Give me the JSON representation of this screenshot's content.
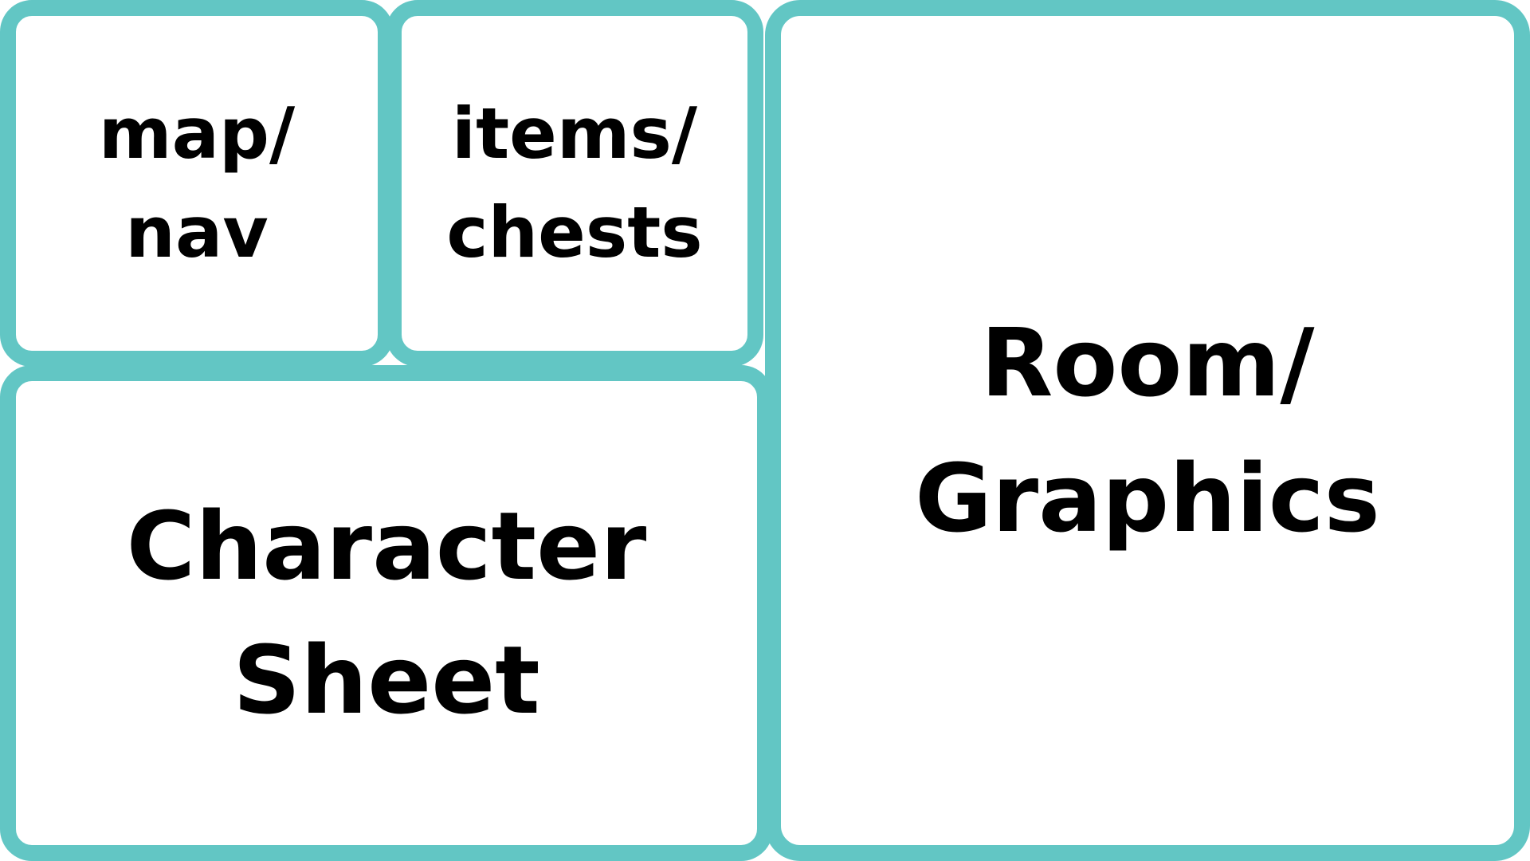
{
  "colors": {
    "panel_border": "#62c6c4",
    "panel_fill": "#ffffff",
    "text": "#000000"
  },
  "panels": {
    "map_nav": {
      "line1": "map/",
      "line2": "nav"
    },
    "items_chests": {
      "line1": "items/",
      "line2": "chests"
    },
    "room_graphics": {
      "line1": "Room/",
      "line2": "Graphics"
    },
    "character_sheet": {
      "line1": "Character",
      "line2": "Sheet"
    }
  }
}
